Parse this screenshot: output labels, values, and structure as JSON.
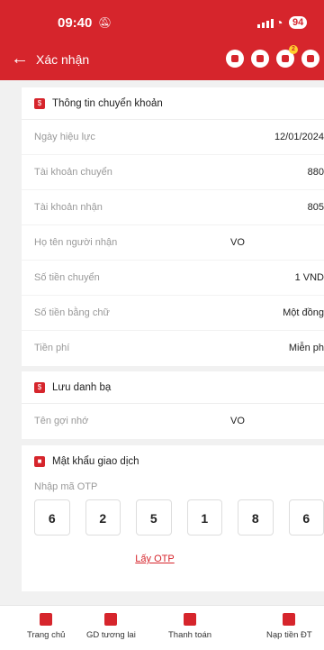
{
  "status_bar": {
    "time": "09:40",
    "mute_icon": "mute-icon",
    "battery": "94"
  },
  "header": {
    "title": "Xác nhận",
    "badge_count": "2"
  },
  "transfer_info": {
    "title": "Thông tin chuyển khoản",
    "rows": [
      {
        "label": "Ngày hiệu lực",
        "value": "12/01/2024"
      },
      {
        "label": "Tài khoản chuyển",
        "value": "880"
      },
      {
        "label": "Tài khoản nhận",
        "value": "805"
      },
      {
        "label": "Họ tên người nhận",
        "value": "VO"
      },
      {
        "label": "Số tiền chuyển",
        "value": "1 VND"
      },
      {
        "label": "Số tiền bằng chữ",
        "value": "Một đồng"
      },
      {
        "label": "Tiền phí",
        "value": "Miễn ph"
      }
    ]
  },
  "contacts": {
    "title": "Lưu danh bạ",
    "rows": [
      {
        "label": "Tên gợi nhớ",
        "value": "VO"
      }
    ]
  },
  "password": {
    "title": "Mật khẩu giao dịch",
    "otp_label": "Nhập mã OTP",
    "otp_digits": [
      "6",
      "2",
      "5",
      "1",
      "8",
      "6"
    ],
    "get_otp": "Lấy OTP"
  },
  "bottom_nav": [
    {
      "label": "Trang chủ",
      "icon": "home-icon"
    },
    {
      "label": "GD tương lai",
      "icon": "future-transaction-icon"
    },
    {
      "label": "Thanh toán",
      "icon": "bill-payment-icon"
    },
    {
      "label": "Nạp tiền ĐT",
      "icon": "phone-topup-icon"
    }
  ],
  "colors": {
    "brand": "#d6252c",
    "background": "#f1f1f1"
  }
}
